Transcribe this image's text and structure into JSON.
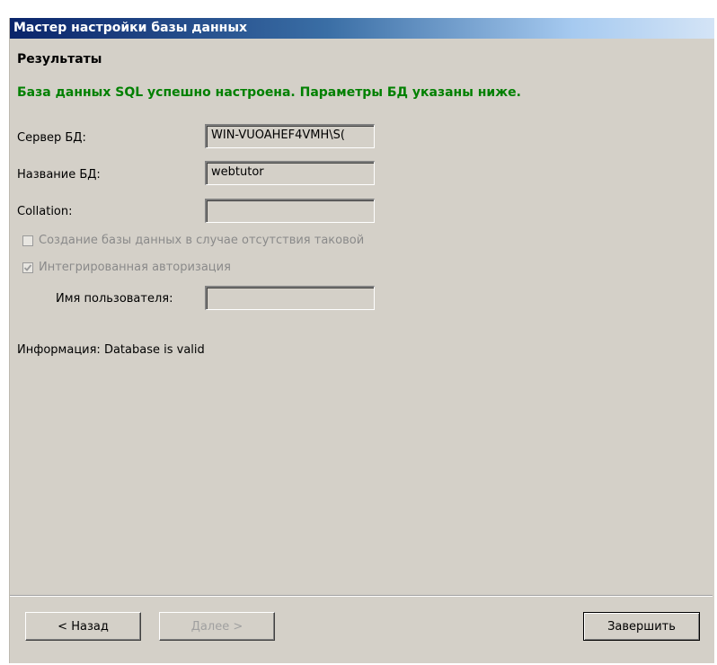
{
  "window": {
    "title": "Мастер настройки базы данных"
  },
  "section": {
    "title": "Результаты"
  },
  "message": {
    "success": "База данных SQL успешно настроена. Параметры БД указаны ниже.",
    "color": "#008000"
  },
  "fields": {
    "server": {
      "label": "Сервер БД:",
      "value": "WIN-VUOAHEF4VMH\\S("
    },
    "dbname": {
      "label": "Название БД:",
      "value": "webtutor"
    },
    "collation": {
      "label": "Collation:",
      "value": ""
    },
    "username": {
      "label": "Имя пользователя:",
      "value": ""
    }
  },
  "checkboxes": {
    "create_db": {
      "label": "Создание базы данных в случае отсутствия таковой",
      "checked": false,
      "enabled": false
    },
    "integrated_auth": {
      "label": "Интегрированная авторизация",
      "checked": true,
      "enabled": false
    }
  },
  "info": {
    "text": "Информация: Database is valid"
  },
  "buttons": {
    "back": "< Назад",
    "next": "Далее >",
    "finish": "Завершить"
  }
}
